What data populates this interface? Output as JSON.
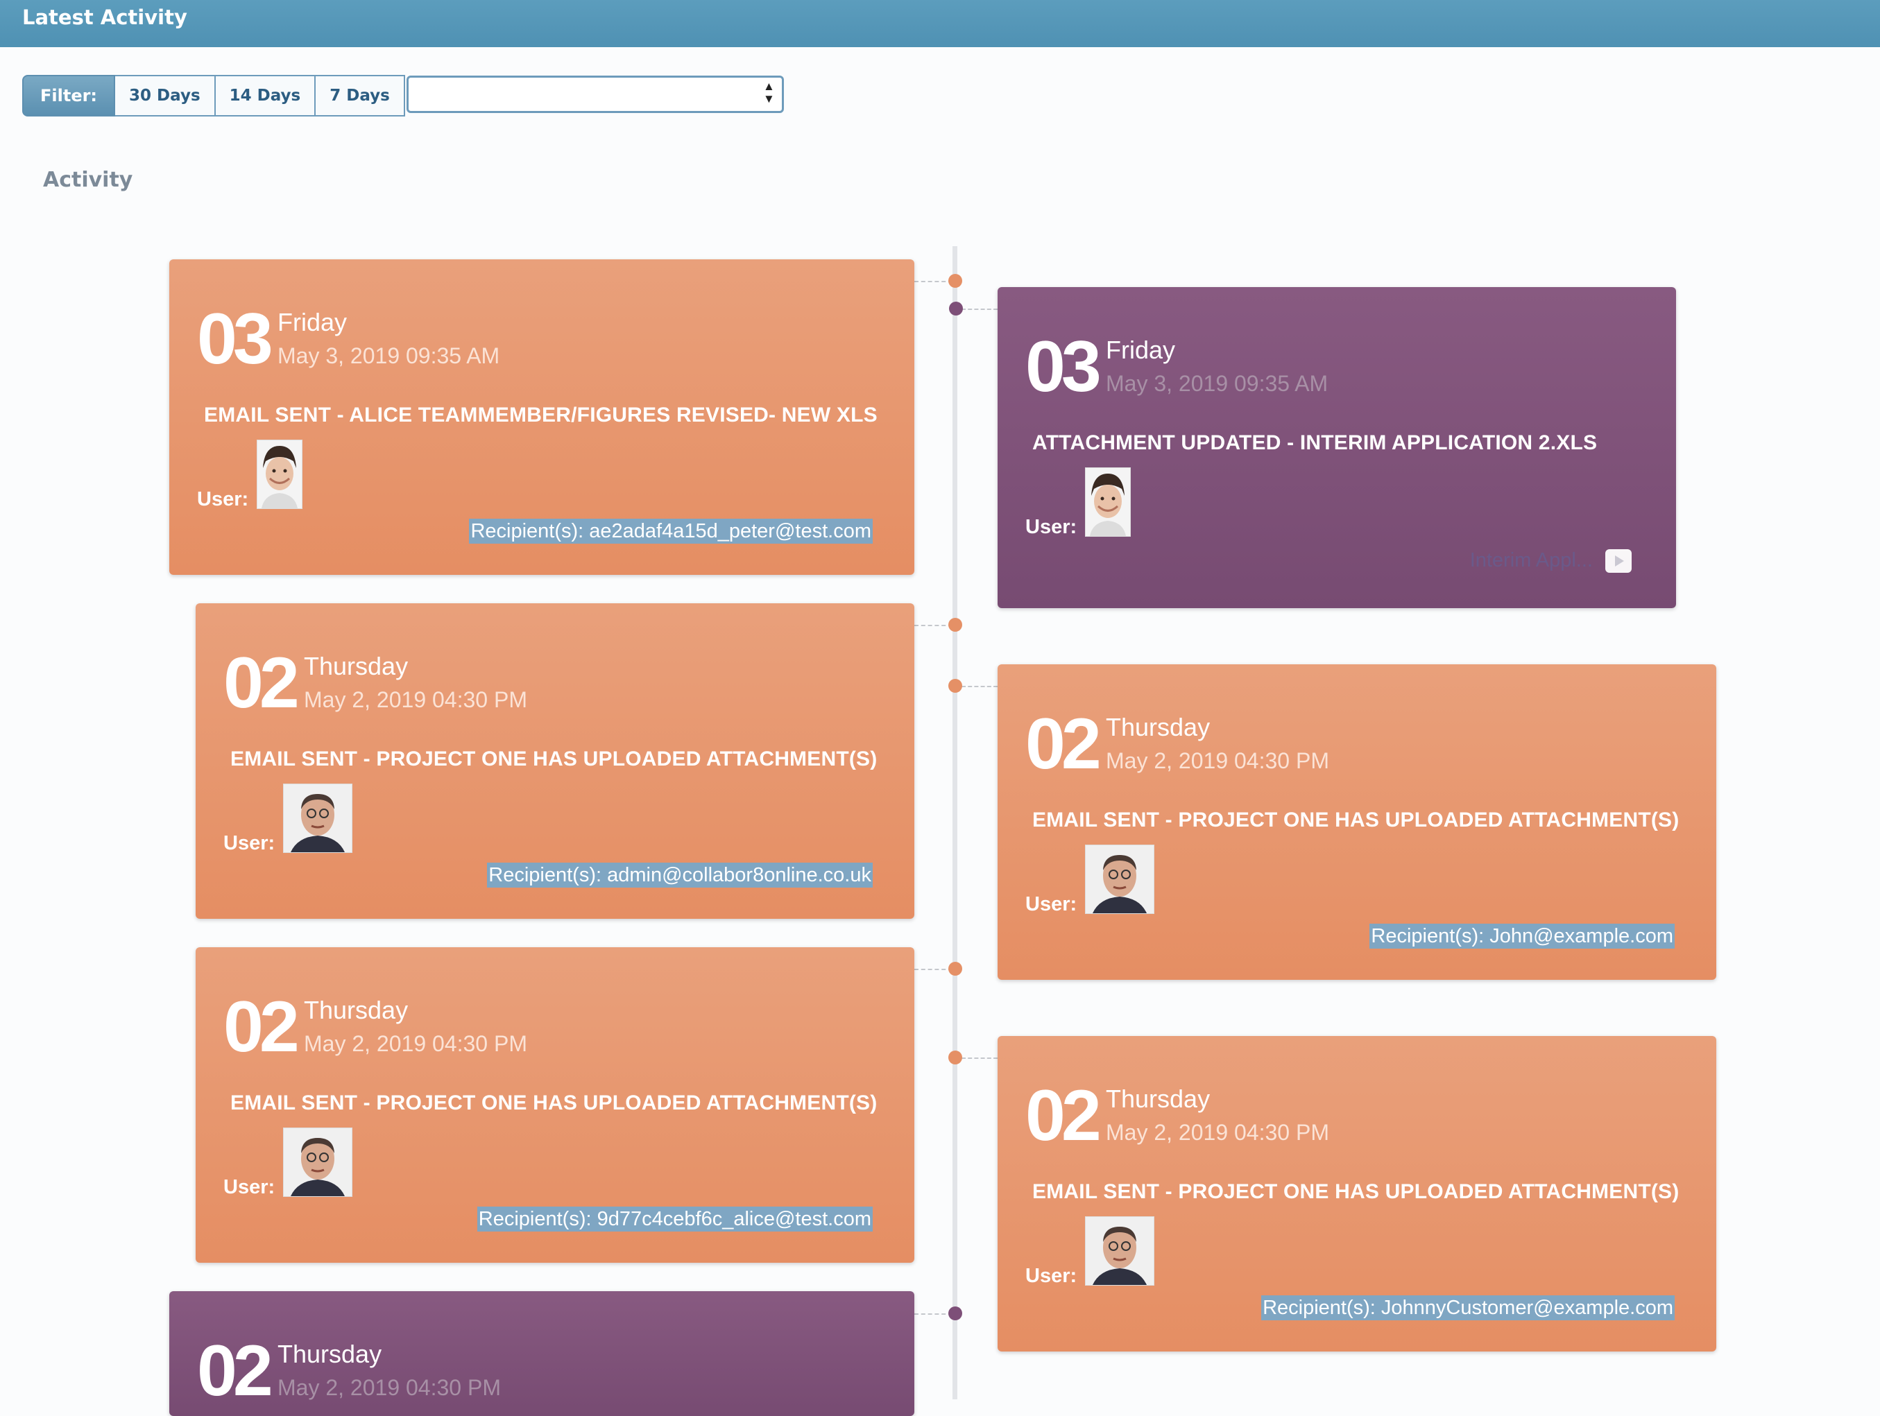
{
  "header": {
    "title": "Latest Activity"
  },
  "filter": {
    "label": "Filter:",
    "buttons": [
      "30 Days",
      "14 Days",
      "7 Days"
    ],
    "select_value": ""
  },
  "section": {
    "title": "Activity"
  },
  "colors": {
    "orange": "#e59066",
    "purple": "#7d4f78",
    "header": "#5c9dbd"
  },
  "cards": [
    {
      "theme": "orange",
      "day": "03",
      "weekday": "Friday",
      "datetime": "May 3, 2019 09:35 AM",
      "event": "EMAIL SENT - ALICE TEAMMEMBER/FIGURES REVISED- NEW XLS",
      "user_label": "User:",
      "avatar": "woman-avatar",
      "recipient": "Recipient(s): ae2adaf4a15d_peter@test.com"
    },
    {
      "theme": "purple",
      "day": "03",
      "weekday": "Friday",
      "datetime": "May 3, 2019 09:35 AM",
      "event": "ATTACHMENT UPDATED - INTERIM APPLICATION 2.XLS",
      "user_label": "User:",
      "avatar": "woman-avatar",
      "attachment_link": "Interim Appl..."
    },
    {
      "theme": "orange",
      "day": "02",
      "weekday": "Thursday",
      "datetime": "May 2, 2019 04:30 PM",
      "event": "EMAIL SENT - PROJECT ONE HAS UPLOADED ATTACHMENT(S)",
      "user_label": "User:",
      "avatar": "man-avatar",
      "recipient": "Recipient(s): admin@collabor8online.co.uk"
    },
    {
      "theme": "orange",
      "day": "02",
      "weekday": "Thursday",
      "datetime": "May 2, 2019 04:30 PM",
      "event": "EMAIL SENT - PROJECT ONE HAS UPLOADED ATTACHMENT(S)",
      "user_label": "User:",
      "avatar": "man-avatar",
      "recipient": "Recipient(s): John@example.com"
    },
    {
      "theme": "orange",
      "day": "02",
      "weekday": "Thursday",
      "datetime": "May 2, 2019 04:30 PM",
      "event": "EMAIL SENT - PROJECT ONE HAS UPLOADED ATTACHMENT(S)",
      "user_label": "User:",
      "avatar": "man-avatar",
      "recipient": "Recipient(s): 9d77c4cebf6c_alice@test.com"
    },
    {
      "theme": "orange",
      "day": "02",
      "weekday": "Thursday",
      "datetime": "May 2, 2019 04:30 PM",
      "event": "EMAIL SENT - PROJECT ONE HAS UPLOADED ATTACHMENT(S)",
      "user_label": "User:",
      "avatar": "man-avatar",
      "recipient": "Recipient(s): JohnnyCustomer@example.com"
    },
    {
      "theme": "purple",
      "day": "02",
      "weekday": "Thursday",
      "datetime": "May 2, 2019 04:30 PM"
    }
  ]
}
